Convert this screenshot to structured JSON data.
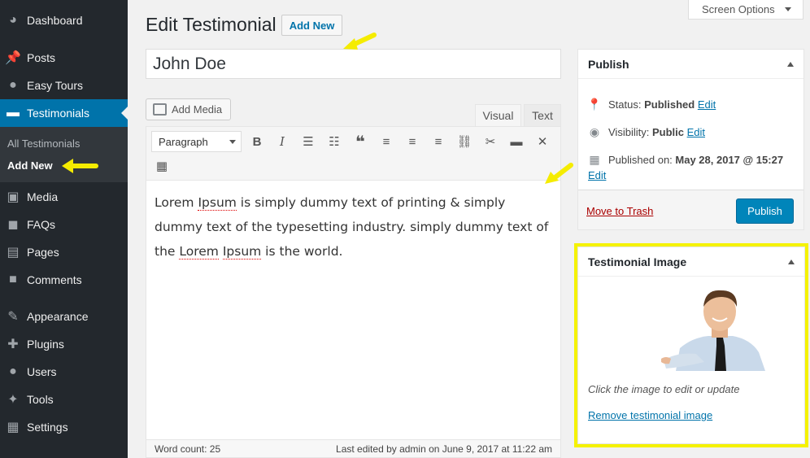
{
  "sidebar": {
    "items": [
      {
        "label": "Dashboard",
        "icon": "dashboard-icon"
      },
      {
        "label": "Posts",
        "icon": "pin-icon"
      },
      {
        "label": "Easy Tours",
        "icon": "globe-icon"
      },
      {
        "label": "Testimonials",
        "icon": "comment-icon"
      },
      {
        "label": "Media",
        "icon": "media-icon"
      },
      {
        "label": "FAQs",
        "icon": "comments-icon"
      },
      {
        "label": "Pages",
        "icon": "pages-icon"
      },
      {
        "label": "Comments",
        "icon": "comment-bubble-icon"
      },
      {
        "label": "Appearance",
        "icon": "brush-icon"
      },
      {
        "label": "Plugins",
        "icon": "plugin-icon"
      },
      {
        "label": "Users",
        "icon": "user-icon"
      },
      {
        "label": "Tools",
        "icon": "wrench-icon"
      },
      {
        "label": "Settings",
        "icon": "settings-icon"
      }
    ],
    "submenu": [
      "All Testimonials",
      "Add New"
    ]
  },
  "header": {
    "title": "Edit Testimonial",
    "add_new": "Add New",
    "screen_options": "Screen Options"
  },
  "post": {
    "title": "John Doe"
  },
  "editor": {
    "add_media": "Add Media",
    "tab_visual": "Visual",
    "tab_text": "Text",
    "format": "Paragraph",
    "content_parts": [
      "Lorem ",
      "Ipsum",
      " is simply dummy text of printing & simply dummy text of the typesetting industry. simply dummy text of the ",
      "Lorem",
      " ",
      "Ipsum",
      " is the world."
    ],
    "word_count": "Word count: 25",
    "last_edited": "Last edited by admin on June 9, 2017 at 11:22 am"
  },
  "publish": {
    "title": "Publish",
    "status_label": "Status: ",
    "status_value": "Published",
    "visibility_label": "Visibility: ",
    "visibility_value": "Public",
    "published_on_label": "Published on: ",
    "published_on_value": "May 28, 2017 @ 15:27",
    "edit": "Edit",
    "trash": "Move to Trash",
    "button": "Publish"
  },
  "testimonial_image": {
    "title": "Testimonial Image",
    "help": "Click the image to edit or update",
    "remove": "Remove testimonial image"
  },
  "colors": {
    "sidebar_bg": "#23282d",
    "accent": "#0073aa",
    "highlight": "#f5f200"
  }
}
